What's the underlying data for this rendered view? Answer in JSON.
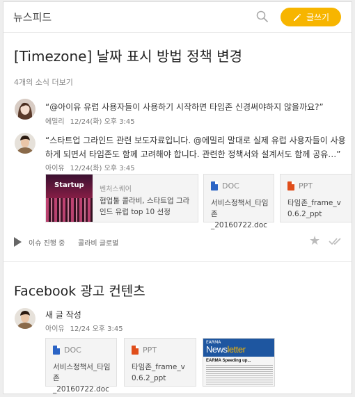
{
  "header": {
    "title": "뉴스피드",
    "write_label": "글쓰기"
  },
  "post1": {
    "title": "[Timezone] 날짜 표시 방법 정책 변경",
    "more_news": "4개의 소식 더보기",
    "comment1": {
      "text": "“@아이유 유럽 사용자들이 사용하기 시작하면 타임존 신경써야하지 않을까요?”",
      "author": "에밀리",
      "time": "12/24(화) 오후 3:45"
    },
    "comment2": {
      "text_line1": "“스타트업 그라인드 관련 보도자료입니다. @에밀리 말대로 실제 유럽 사용자들이 사용",
      "text_line2": "하게 되면서 타임존도 함께 고려해야 합니다. 관련한 정책서와 설계서도 함께 공유…”",
      "author": "아이유",
      "time": "12/24(화) 오후 3:45"
    },
    "link_card": {
      "thumb_brand": "Startup",
      "source": "벤처스퀘어",
      "desc": "협업툴 콜라비, 스타트업 그라인드 유럽 top 10 선정"
    },
    "files": [
      {
        "type": "DOC",
        "name_line1": "서비스정책서_타임존",
        "name_line2": "_20160722.doc"
      },
      {
        "type": "PPT",
        "name_line1": "타임존_frame_v",
        "name_line2": "0.6.2_ppt"
      }
    ],
    "footer": {
      "status": "이슈 진행 중",
      "tag": "콜라비 글로벌"
    }
  },
  "post2": {
    "title": "Facebook 광고 컨텐츠",
    "action": "새 글 작성",
    "author": "아이유",
    "time": "12/24 오후 3:45",
    "files": [
      {
        "type": "DOC",
        "name_line1": "서비스정책서_타임존",
        "name_line2": "_20160722.doc"
      },
      {
        "type": "PPT",
        "name_line1": "타임존_frame_v",
        "name_line2": "0.6.2_ppt"
      }
    ],
    "newsletter": {
      "small": "EARMA",
      "big_a": "News",
      "big_b": "letter",
      "headline": "EARMA Speeding up..."
    }
  },
  "colors": {
    "accent": "#f7b500",
    "doc": "#2b64c5",
    "ppt": "#e04e1b"
  },
  "icons": [
    "search-icon",
    "pencil-icon",
    "play-icon",
    "star-icon",
    "double-check-icon",
    "doc-icon",
    "ppt-icon"
  ]
}
